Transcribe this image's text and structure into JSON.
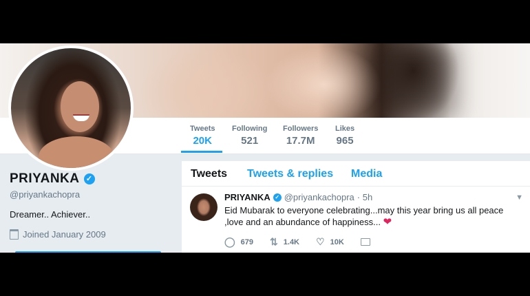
{
  "profile": {
    "name": "PRIYANKA",
    "handle": "@priyankachopra",
    "bio": "Dreamer.. Achiever..",
    "joined": "Joined January 2009",
    "verified_mark": "✓"
  },
  "stats": [
    {
      "label": "Tweets",
      "value": "20K"
    },
    {
      "label": "Following",
      "value": "521"
    },
    {
      "label": "Followers",
      "value": "17.7M"
    },
    {
      "label": "Likes",
      "value": "965"
    }
  ],
  "tabs": [
    "Tweets",
    "Tweets & replies",
    "Media"
  ],
  "tweet": {
    "name": "PRIYANKA",
    "handle": "@priyankachopra",
    "time": "· 5h",
    "text": "Eid Mubarak to everyone celebrating...may this year bring us all peace ,love and an abundance of happiness... ",
    "replies": "679",
    "retweets": "1.4K",
    "likes": "10K"
  },
  "icons": {
    "calendar": "calendar-icon",
    "verified": "verified-badge-icon",
    "reply": "reply-icon",
    "retweet": "retweet-icon",
    "like": "heart-icon",
    "dm": "mail-icon",
    "heart_emoji": "red-heart-icon"
  },
  "colors": {
    "accent": "#1da1f2",
    "heart": "#e0245e"
  }
}
